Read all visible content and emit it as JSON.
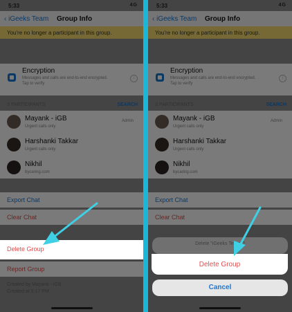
{
  "status": {
    "time": "5:33",
    "signal": "4G"
  },
  "nav": {
    "back": "‹ iGeeks Team",
    "title": "Group Info"
  },
  "banner": "You're no longer a participant in this group.",
  "encryption": {
    "title": "Encryption",
    "subtitle": "Messages and calls are end-to-end encrypted.",
    "tap": "Tap to verify"
  },
  "participants": {
    "header": "3 PARTICIPANTS",
    "search": "SEARCH"
  },
  "members": [
    {
      "name": "Mayank - iGB",
      "status": "Urgent calls only",
      "badge": "Admin"
    },
    {
      "name": "Harshanki Takkar",
      "status": "Urgent calls only"
    },
    {
      "name": "Nikhil",
      "status": "bycaring.com"
    }
  ],
  "actions": {
    "export": "Export Chat",
    "clear": "Clear Chat",
    "delete": "Delete Group",
    "report": "Report Group"
  },
  "footer": {
    "created_by": "Created by Mayank - iGB",
    "created_at": "Created at 5:17 PM"
  },
  "sheet": {
    "title": "Delete \"iGeeks Team\"?",
    "delete": "Delete Group",
    "cancel": "Cancel"
  },
  "colors": {
    "accent": "#1ab7d9",
    "danger": "#e54b4b",
    "link": "#1a76d2",
    "banner": "#f7dc6f"
  }
}
